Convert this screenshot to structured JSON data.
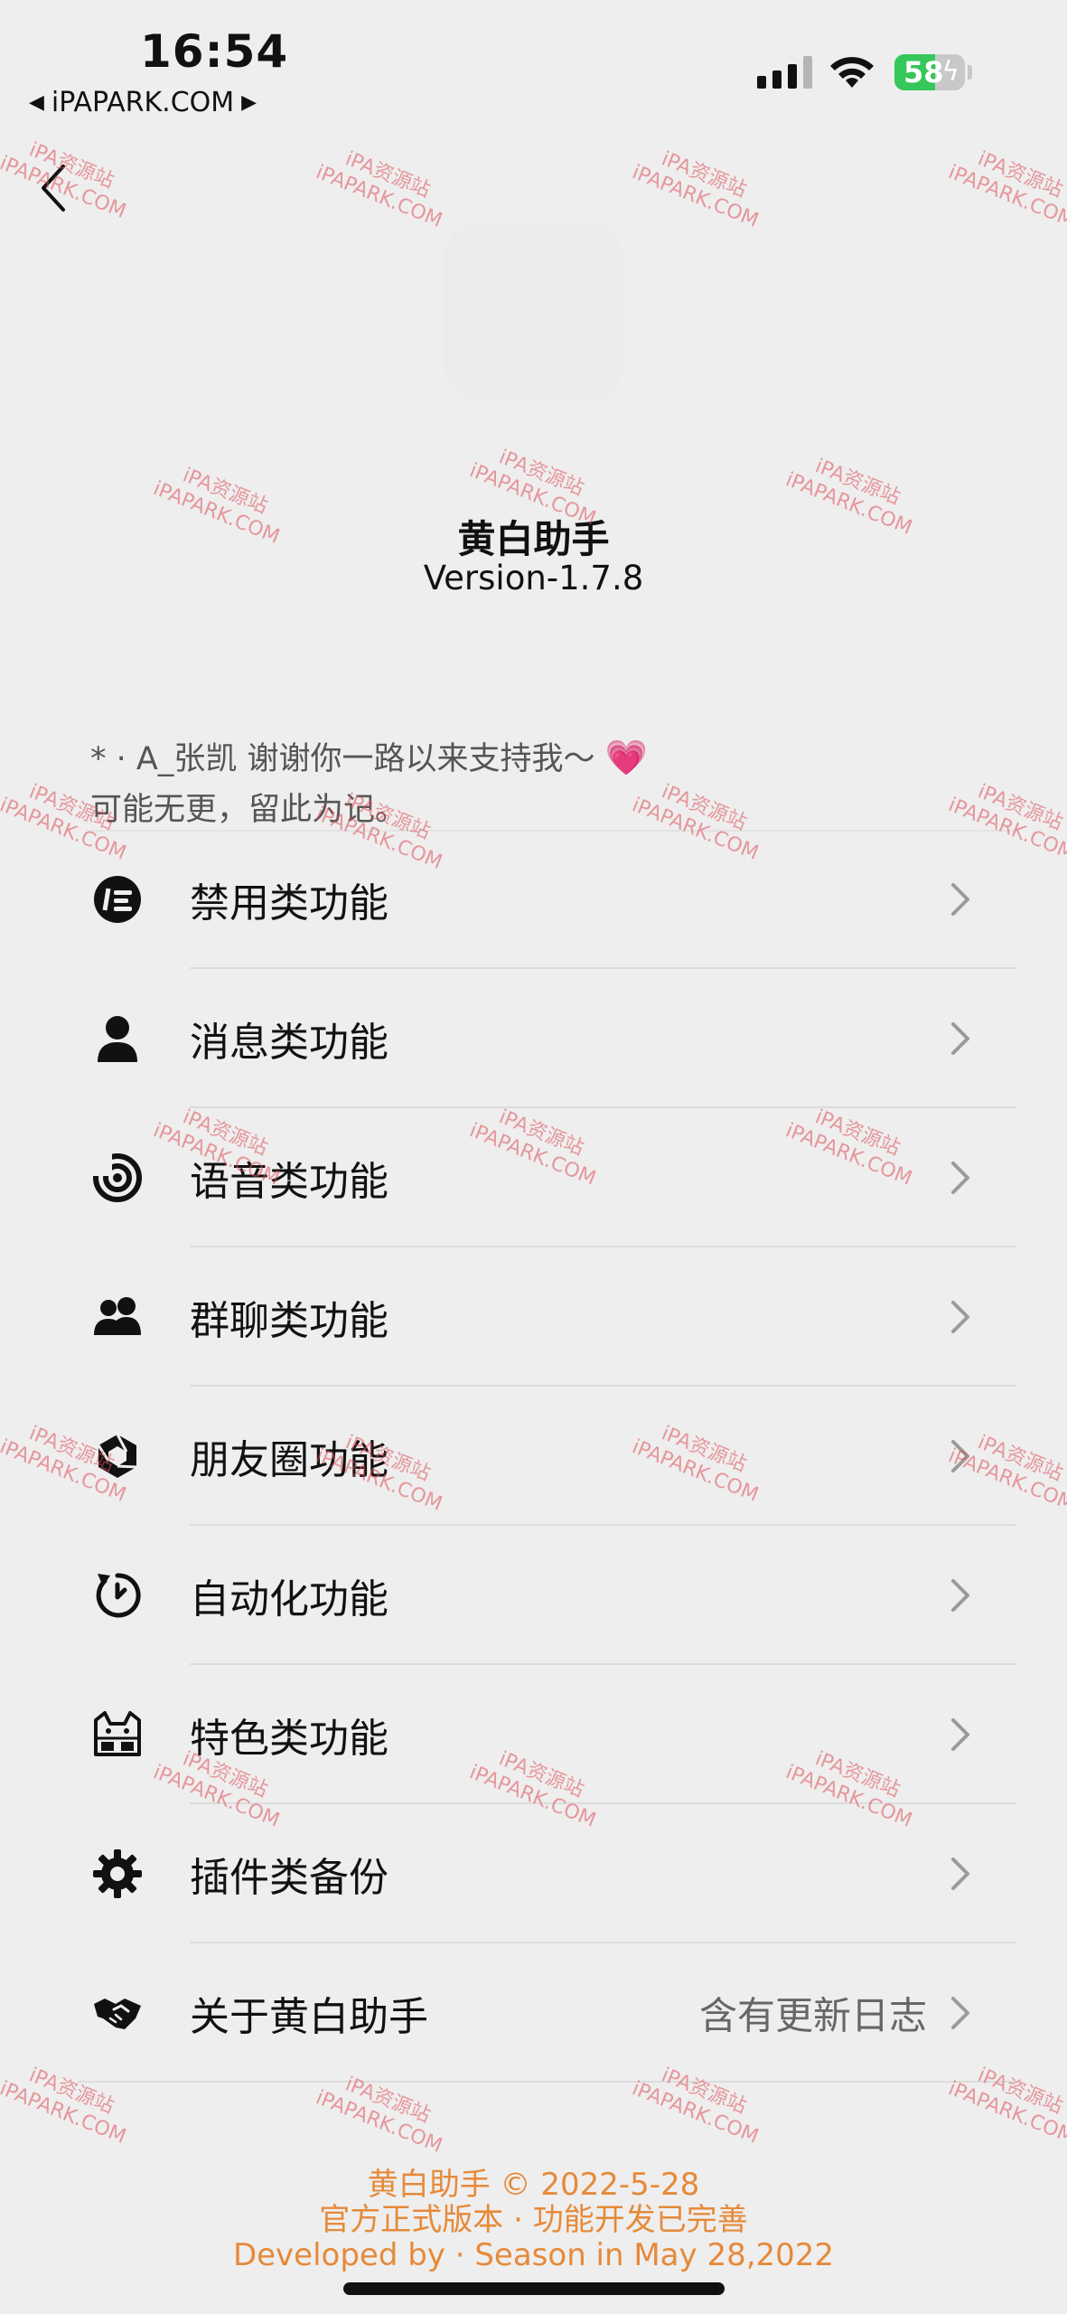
{
  "status_bar": {
    "time": "16:54",
    "carrier": "iPAPARK.COM",
    "battery_percent": "58",
    "battery_level": 0.58
  },
  "header": {
    "title": "黄白助手",
    "version": "Version-1.7.8"
  },
  "note": {
    "line1": "*    · A_张凯 谢谢你一路以来支持我～",
    "heart": "💗",
    "line2": "可能无更，留此为记。"
  },
  "menu": [
    {
      "label": "禁用类功能",
      "icon": "ban-face-icon",
      "value": ""
    },
    {
      "label": "消息类功能",
      "icon": "person-icon",
      "value": ""
    },
    {
      "label": "语音类功能",
      "icon": "voice-icon",
      "value": ""
    },
    {
      "label": "群聊类功能",
      "icon": "group-icon",
      "value": ""
    },
    {
      "label": "朋友圈功能",
      "icon": "aperture-icon",
      "value": ""
    },
    {
      "label": "自动化功能",
      "icon": "clock-refresh-icon",
      "value": ""
    },
    {
      "label": "特色类功能",
      "icon": "cat-icon",
      "value": ""
    },
    {
      "label": "插件类备份",
      "icon": "gear-icon",
      "value": ""
    },
    {
      "label": "关于黄白助手",
      "icon": "handshake-icon",
      "value": "含有更新日志"
    }
  ],
  "footer": {
    "line1": "黄白助手 © 2022-5-28",
    "line2": "官方正式版本 · 功能开发已完善",
    "line3": "Developed by · Season in May 28,2022"
  },
  "watermark": {
    "line1": "iPA资源站",
    "line2": "iPAPARK.COM"
  },
  "colors": {
    "background": "#efeeee",
    "footer_text": "#e58a3a",
    "battery_green": "#35c759",
    "watermark": "#dc505a"
  }
}
